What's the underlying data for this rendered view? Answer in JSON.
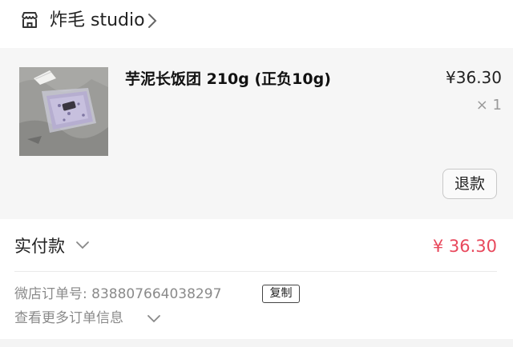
{
  "shop": {
    "name": "炸毛 studio",
    "icon": "store-icon",
    "chevron_icon": "chevron-right-icon"
  },
  "item": {
    "title": "芋泥长饭团 210g (正负10g)",
    "price": "¥36.30",
    "quantity": "× 1",
    "refund_label": "退款",
    "image": "product-photo"
  },
  "payment": {
    "label": "实付款",
    "amount": "¥ 36.30",
    "amount_color": "#e8485c",
    "chevron_icon": "chevron-down-icon"
  },
  "order": {
    "number_label": "微店订单号:",
    "number": "838807664038297",
    "copy_label": "复制",
    "more_label": "查看更多订单信息",
    "more_icon": "chevron-down-icon"
  }
}
